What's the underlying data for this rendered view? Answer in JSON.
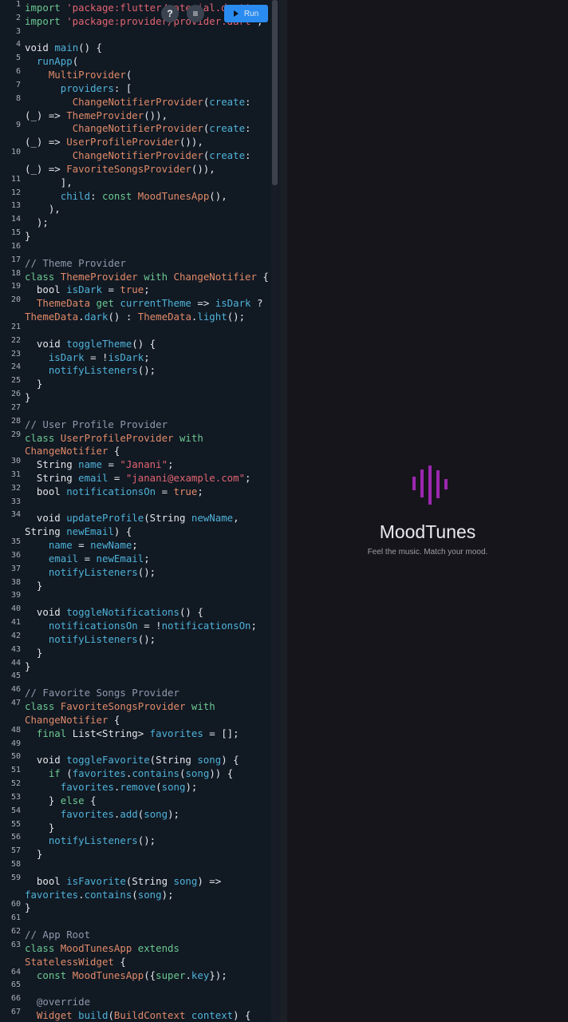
{
  "toolbar": {
    "help_icon": "?",
    "format_icon": "≡",
    "run_label": "Run"
  },
  "preview": {
    "app_title": "MoodTunes",
    "tagline": "Feel the music. Match your mood.",
    "logo_color": "#9c27b0"
  },
  "code": [
    {
      "n": "1",
      "t": [
        [
          "k",
          "import "
        ],
        [
          "s",
          "'package:flutter/material.dart'"
        ],
        [
          "p",
          ";"
        ]
      ]
    },
    {
      "n": "2",
      "t": [
        [
          "k",
          "import "
        ],
        [
          "s",
          "'package:provider/provider.dart'"
        ],
        [
          "p",
          ";"
        ]
      ]
    },
    {
      "n": "3",
      "t": []
    },
    {
      "n": "4",
      "t": [
        [
          "p",
          "void "
        ],
        [
          "f",
          "main"
        ],
        [
          "p",
          "() {"
        ]
      ]
    },
    {
      "n": "5",
      "t": [
        [
          "p",
          "  "
        ],
        [
          "f",
          "runApp"
        ],
        [
          "p",
          "("
        ]
      ]
    },
    {
      "n": "6",
      "t": [
        [
          "p",
          "    "
        ],
        [
          "t",
          "MultiProvider"
        ],
        [
          "p",
          "("
        ]
      ]
    },
    {
      "n": "7",
      "t": [
        [
          "p",
          "      "
        ],
        [
          "f",
          "providers"
        ],
        [
          "p",
          ": ["
        ]
      ]
    },
    {
      "n": "8",
      "t": [
        [
          "p",
          "        "
        ],
        [
          "t",
          "ChangeNotifierProvider"
        ],
        [
          "p",
          "("
        ],
        [
          "f",
          "create"
        ],
        [
          "p",
          ":"
        ]
      ]
    },
    {
      "n": "",
      "t": [
        [
          "p",
          "(_) => "
        ],
        [
          "t",
          "ThemeProvider"
        ],
        [
          "p",
          "()),"
        ]
      ]
    },
    {
      "n": "9",
      "t": [
        [
          "p",
          "        "
        ],
        [
          "t",
          "ChangeNotifierProvider"
        ],
        [
          "p",
          "("
        ],
        [
          "f",
          "create"
        ],
        [
          "p",
          ":"
        ]
      ]
    },
    {
      "n": "",
      "t": [
        [
          "p",
          "(_) => "
        ],
        [
          "t",
          "UserProfileProvider"
        ],
        [
          "p",
          "()),"
        ]
      ]
    },
    {
      "n": "10",
      "t": [
        [
          "p",
          "        "
        ],
        [
          "t",
          "ChangeNotifierProvider"
        ],
        [
          "p",
          "("
        ],
        [
          "f",
          "create"
        ],
        [
          "p",
          ":"
        ]
      ]
    },
    {
      "n": "",
      "t": [
        [
          "p",
          "(_) => "
        ],
        [
          "t",
          "FavoriteSongsProvider"
        ],
        [
          "p",
          "()),"
        ]
      ]
    },
    {
      "n": "11",
      "t": [
        [
          "p",
          "      ],"
        ]
      ]
    },
    {
      "n": "12",
      "t": [
        [
          "p",
          "      "
        ],
        [
          "f",
          "child"
        ],
        [
          "p",
          ": "
        ],
        [
          "k",
          "const "
        ],
        [
          "t",
          "MoodTunesApp"
        ],
        [
          "p",
          "(),"
        ]
      ]
    },
    {
      "n": "13",
      "t": [
        [
          "p",
          "    ),"
        ]
      ]
    },
    {
      "n": "14",
      "t": [
        [
          "p",
          "  );"
        ]
      ]
    },
    {
      "n": "15",
      "t": [
        [
          "p",
          "}"
        ]
      ]
    },
    {
      "n": "16",
      "t": []
    },
    {
      "n": "17",
      "t": [
        [
          "c",
          "// Theme Provider"
        ]
      ]
    },
    {
      "n": "18",
      "t": [
        [
          "k",
          "class "
        ],
        [
          "t",
          "ThemeProvider "
        ],
        [
          "k",
          "with "
        ],
        [
          "t",
          "ChangeNotifier "
        ],
        [
          "p",
          "{"
        ]
      ]
    },
    {
      "n": "19",
      "t": [
        [
          "p",
          "  bool "
        ],
        [
          "f",
          "isDark"
        ],
        [
          "p",
          " = "
        ],
        [
          "t",
          "true"
        ],
        [
          "p",
          ";"
        ]
      ]
    },
    {
      "n": "20",
      "t": [
        [
          "p",
          "  "
        ],
        [
          "t",
          "ThemeData "
        ],
        [
          "k",
          "get "
        ],
        [
          "f",
          "currentTheme"
        ],
        [
          "p",
          " => "
        ],
        [
          "f",
          "isDark"
        ],
        [
          "p",
          " ?"
        ]
      ]
    },
    {
      "n": "",
      "t": [
        [
          "t",
          "ThemeData"
        ],
        [
          "p",
          "."
        ],
        [
          "f",
          "dark"
        ],
        [
          "p",
          "() : "
        ],
        [
          "t",
          "ThemeData"
        ],
        [
          "p",
          "."
        ],
        [
          "f",
          "light"
        ],
        [
          "p",
          "();"
        ]
      ]
    },
    {
      "n": "21",
      "t": []
    },
    {
      "n": "22",
      "t": [
        [
          "p",
          "  void "
        ],
        [
          "f",
          "toggleTheme"
        ],
        [
          "p",
          "() {"
        ]
      ]
    },
    {
      "n": "23",
      "t": [
        [
          "p",
          "    "
        ],
        [
          "f",
          "isDark"
        ],
        [
          "p",
          " = !"
        ],
        [
          "f",
          "isDark"
        ],
        [
          "p",
          ";"
        ]
      ]
    },
    {
      "n": "24",
      "t": [
        [
          "p",
          "    "
        ],
        [
          "f",
          "notifyListeners"
        ],
        [
          "p",
          "();"
        ]
      ]
    },
    {
      "n": "25",
      "t": [
        [
          "p",
          "  }"
        ]
      ]
    },
    {
      "n": "26",
      "t": [
        [
          "p",
          "}"
        ]
      ]
    },
    {
      "n": "27",
      "t": []
    },
    {
      "n": "28",
      "t": [
        [
          "c",
          "// User Profile Provider"
        ]
      ]
    },
    {
      "n": "29",
      "t": [
        [
          "k",
          "class "
        ],
        [
          "t",
          "UserProfileProvider "
        ],
        [
          "k",
          "with"
        ]
      ]
    },
    {
      "n": "",
      "t": [
        [
          "t",
          "ChangeNotifier "
        ],
        [
          "p",
          "{"
        ]
      ]
    },
    {
      "n": "30",
      "t": [
        [
          "p",
          "  String "
        ],
        [
          "f",
          "name"
        ],
        [
          "p",
          " = "
        ],
        [
          "s",
          "\"Janani\""
        ],
        [
          "p",
          ";"
        ]
      ]
    },
    {
      "n": "31",
      "t": [
        [
          "p",
          "  String "
        ],
        [
          "f",
          "email"
        ],
        [
          "p",
          " = "
        ],
        [
          "s",
          "\"janani@example.com\""
        ],
        [
          "p",
          ";"
        ]
      ]
    },
    {
      "n": "32",
      "t": [
        [
          "p",
          "  bool "
        ],
        [
          "f",
          "notificationsOn"
        ],
        [
          "p",
          " = "
        ],
        [
          "t",
          "true"
        ],
        [
          "p",
          ";"
        ]
      ]
    },
    {
      "n": "33",
      "t": []
    },
    {
      "n": "34",
      "t": [
        [
          "p",
          "  void "
        ],
        [
          "f",
          "updateProfile"
        ],
        [
          "p",
          "(String "
        ],
        [
          "f",
          "newName"
        ],
        [
          "p",
          ","
        ]
      ]
    },
    {
      "n": "",
      "t": [
        [
          "p",
          "String "
        ],
        [
          "f",
          "newEmail"
        ],
        [
          "p",
          ") {"
        ]
      ]
    },
    {
      "n": "35",
      "t": [
        [
          "p",
          "    "
        ],
        [
          "f",
          "name"
        ],
        [
          "p",
          " = "
        ],
        [
          "f",
          "newName"
        ],
        [
          "p",
          ";"
        ]
      ]
    },
    {
      "n": "36",
      "t": [
        [
          "p",
          "    "
        ],
        [
          "f",
          "email"
        ],
        [
          "p",
          " = "
        ],
        [
          "f",
          "newEmail"
        ],
        [
          "p",
          ";"
        ]
      ]
    },
    {
      "n": "37",
      "t": [
        [
          "p",
          "    "
        ],
        [
          "f",
          "notifyListeners"
        ],
        [
          "p",
          "();"
        ]
      ]
    },
    {
      "n": "38",
      "t": [
        [
          "p",
          "  }"
        ]
      ]
    },
    {
      "n": "39",
      "t": []
    },
    {
      "n": "40",
      "t": [
        [
          "p",
          "  void "
        ],
        [
          "f",
          "toggleNotifications"
        ],
        [
          "p",
          "() {"
        ]
      ]
    },
    {
      "n": "41",
      "t": [
        [
          "p",
          "    "
        ],
        [
          "f",
          "notificationsOn"
        ],
        [
          "p",
          " = !"
        ],
        [
          "f",
          "notificationsOn"
        ],
        [
          "p",
          ";"
        ]
      ]
    },
    {
      "n": "42",
      "t": [
        [
          "p",
          "    "
        ],
        [
          "f",
          "notifyListeners"
        ],
        [
          "p",
          "();"
        ]
      ]
    },
    {
      "n": "43",
      "t": [
        [
          "p",
          "  }"
        ]
      ]
    },
    {
      "n": "44",
      "t": [
        [
          "p",
          "}"
        ]
      ]
    },
    {
      "n": "45",
      "t": []
    },
    {
      "n": "46",
      "t": [
        [
          "c",
          "// Favorite Songs Provider"
        ]
      ]
    },
    {
      "n": "47",
      "t": [
        [
          "k",
          "class "
        ],
        [
          "t",
          "FavoriteSongsProvider "
        ],
        [
          "k",
          "with"
        ]
      ]
    },
    {
      "n": "",
      "t": [
        [
          "t",
          "ChangeNotifier "
        ],
        [
          "p",
          "{"
        ]
      ]
    },
    {
      "n": "48",
      "t": [
        [
          "p",
          "  "
        ],
        [
          "k",
          "final "
        ],
        [
          "p",
          "List<String> "
        ],
        [
          "f",
          "favorites"
        ],
        [
          "p",
          " = [];"
        ]
      ]
    },
    {
      "n": "49",
      "t": []
    },
    {
      "n": "50",
      "t": [
        [
          "p",
          "  void "
        ],
        [
          "f",
          "toggleFavorite"
        ],
        [
          "p",
          "(String "
        ],
        [
          "f",
          "song"
        ],
        [
          "p",
          ") {"
        ]
      ]
    },
    {
      "n": "51",
      "t": [
        [
          "p",
          "    "
        ],
        [
          "k",
          "if "
        ],
        [
          "p",
          "("
        ],
        [
          "f",
          "favorites"
        ],
        [
          "p",
          "."
        ],
        [
          "f",
          "contains"
        ],
        [
          "p",
          "("
        ],
        [
          "f",
          "song"
        ],
        [
          "p",
          ")) {"
        ]
      ]
    },
    {
      "n": "52",
      "t": [
        [
          "p",
          "      "
        ],
        [
          "f",
          "favorites"
        ],
        [
          "p",
          "."
        ],
        [
          "f",
          "remove"
        ],
        [
          "p",
          "("
        ],
        [
          "f",
          "song"
        ],
        [
          "p",
          ");"
        ]
      ]
    },
    {
      "n": "53",
      "t": [
        [
          "p",
          "    } "
        ],
        [
          "k",
          "else "
        ],
        [
          "p",
          "{"
        ]
      ]
    },
    {
      "n": "54",
      "t": [
        [
          "p",
          "      "
        ],
        [
          "f",
          "favorites"
        ],
        [
          "p",
          "."
        ],
        [
          "f",
          "add"
        ],
        [
          "p",
          "("
        ],
        [
          "f",
          "song"
        ],
        [
          "p",
          ");"
        ]
      ]
    },
    {
      "n": "55",
      "t": [
        [
          "p",
          "    }"
        ]
      ]
    },
    {
      "n": "56",
      "t": [
        [
          "p",
          "    "
        ],
        [
          "f",
          "notifyListeners"
        ],
        [
          "p",
          "();"
        ]
      ]
    },
    {
      "n": "57",
      "t": [
        [
          "p",
          "  }"
        ]
      ]
    },
    {
      "n": "58",
      "t": []
    },
    {
      "n": "59",
      "t": [
        [
          "p",
          "  bool "
        ],
        [
          "f",
          "isFavorite"
        ],
        [
          "p",
          "(String "
        ],
        [
          "f",
          "song"
        ],
        [
          "p",
          ") =>"
        ]
      ]
    },
    {
      "n": "",
      "t": [
        [
          "f",
          "favorites"
        ],
        [
          "p",
          "."
        ],
        [
          "f",
          "contains"
        ],
        [
          "p",
          "("
        ],
        [
          "f",
          "song"
        ],
        [
          "p",
          ");"
        ]
      ]
    },
    {
      "n": "60",
      "t": [
        [
          "p",
          "}"
        ]
      ]
    },
    {
      "n": "61",
      "t": []
    },
    {
      "n": "62",
      "t": [
        [
          "c",
          "// App Root"
        ]
      ]
    },
    {
      "n": "63",
      "t": [
        [
          "k",
          "class "
        ],
        [
          "t",
          "MoodTunesApp "
        ],
        [
          "k",
          "extends"
        ]
      ]
    },
    {
      "n": "",
      "t": [
        [
          "t",
          "StatelessWidget "
        ],
        [
          "p",
          "{"
        ]
      ]
    },
    {
      "n": "64",
      "t": [
        [
          "p",
          "  "
        ],
        [
          "k",
          "const "
        ],
        [
          "t",
          "MoodTunesApp"
        ],
        [
          "p",
          "({"
        ],
        [
          "k",
          "super"
        ],
        [
          "p",
          "."
        ],
        [
          "f",
          "key"
        ],
        [
          "p",
          "});"
        ]
      ]
    },
    {
      "n": "65",
      "t": []
    },
    {
      "n": "66",
      "t": [
        [
          "c",
          "  @override"
        ]
      ]
    },
    {
      "n": "67",
      "t": [
        [
          "p",
          "  "
        ],
        [
          "t",
          "Widget "
        ],
        [
          "f",
          "build"
        ],
        [
          "p",
          "("
        ],
        [
          "t",
          "BuildContext "
        ],
        [
          "f",
          "context"
        ],
        [
          "p",
          ") {"
        ]
      ]
    }
  ]
}
